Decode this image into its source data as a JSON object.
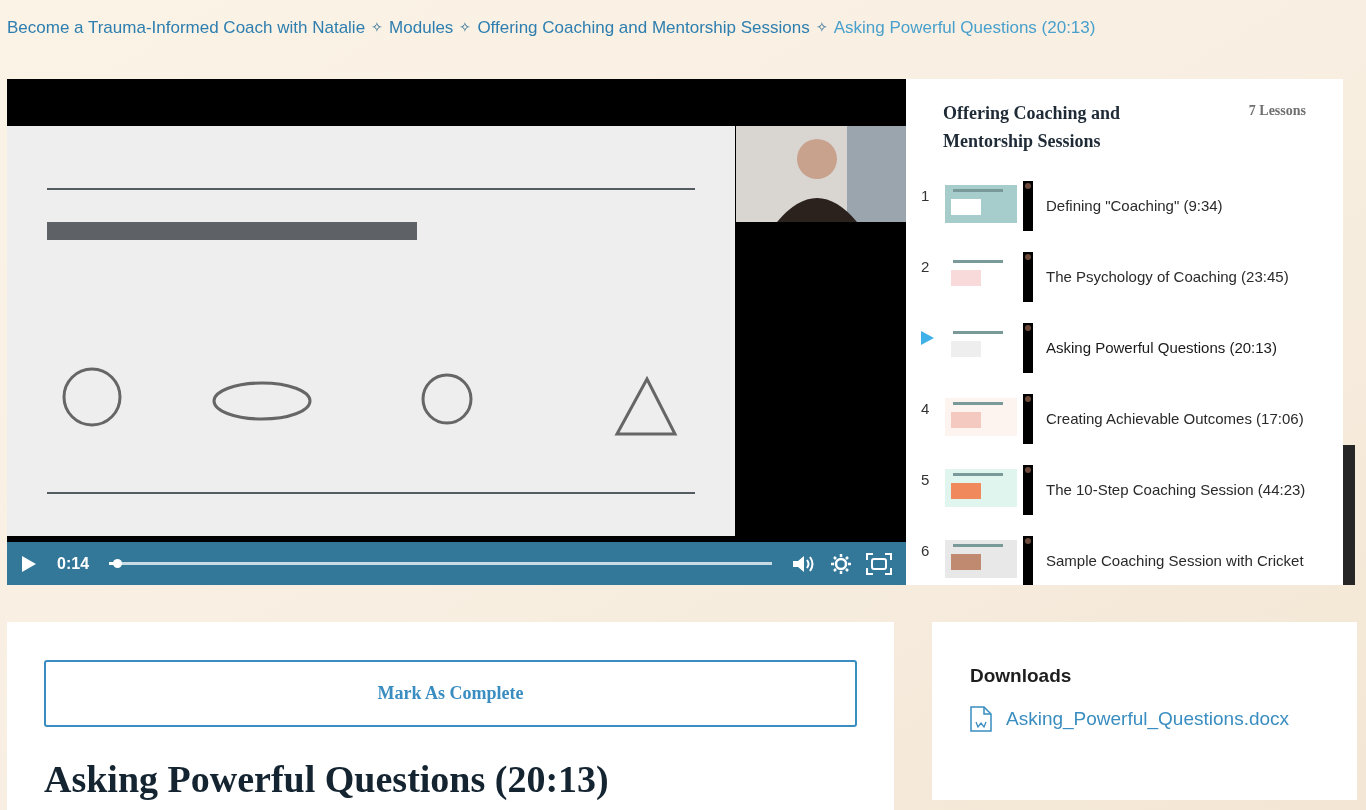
{
  "breadcrumb": [
    {
      "label": "Become a Trauma-Informed Coach with Natalie",
      "current": false
    },
    {
      "label": "Modules",
      "current": false
    },
    {
      "label": "Offering Coaching and Mentorship Sessions",
      "current": false
    },
    {
      "label": "Asking Powerful Questions (20:13)",
      "current": true
    }
  ],
  "breadcrumb_separator": "✧",
  "player": {
    "time": "0:14",
    "level": 0.012
  },
  "sidebar": {
    "title": "Offering Coaching and Mentorship Sessions",
    "count": "7 Lessons",
    "lessons": [
      {
        "number": "1",
        "title": "Defining \"Coaching\" (9:34)",
        "selected": false
      },
      {
        "number": "2",
        "title": "The Psychology of Coaching (23:45)",
        "selected": false
      },
      {
        "title": "Asking Powerful Questions (20:13)",
        "selected": true
      },
      {
        "number": "4",
        "title": "Creating Achievable Outcomes (17:06)",
        "selected": false
      },
      {
        "number": "5",
        "title": "The 10-Step Coaching Session (44:23)",
        "selected": false
      },
      {
        "number": "6",
        "title": "Sample Coaching Session with Cricket",
        "selected": false
      }
    ]
  },
  "complete_button": "Mark As Complete",
  "lesson_title": "Asking Powerful Questions (20:13)",
  "downloads": {
    "title": "Downloads",
    "files": [
      "Asking_Powerful_Questions.docx"
    ]
  }
}
